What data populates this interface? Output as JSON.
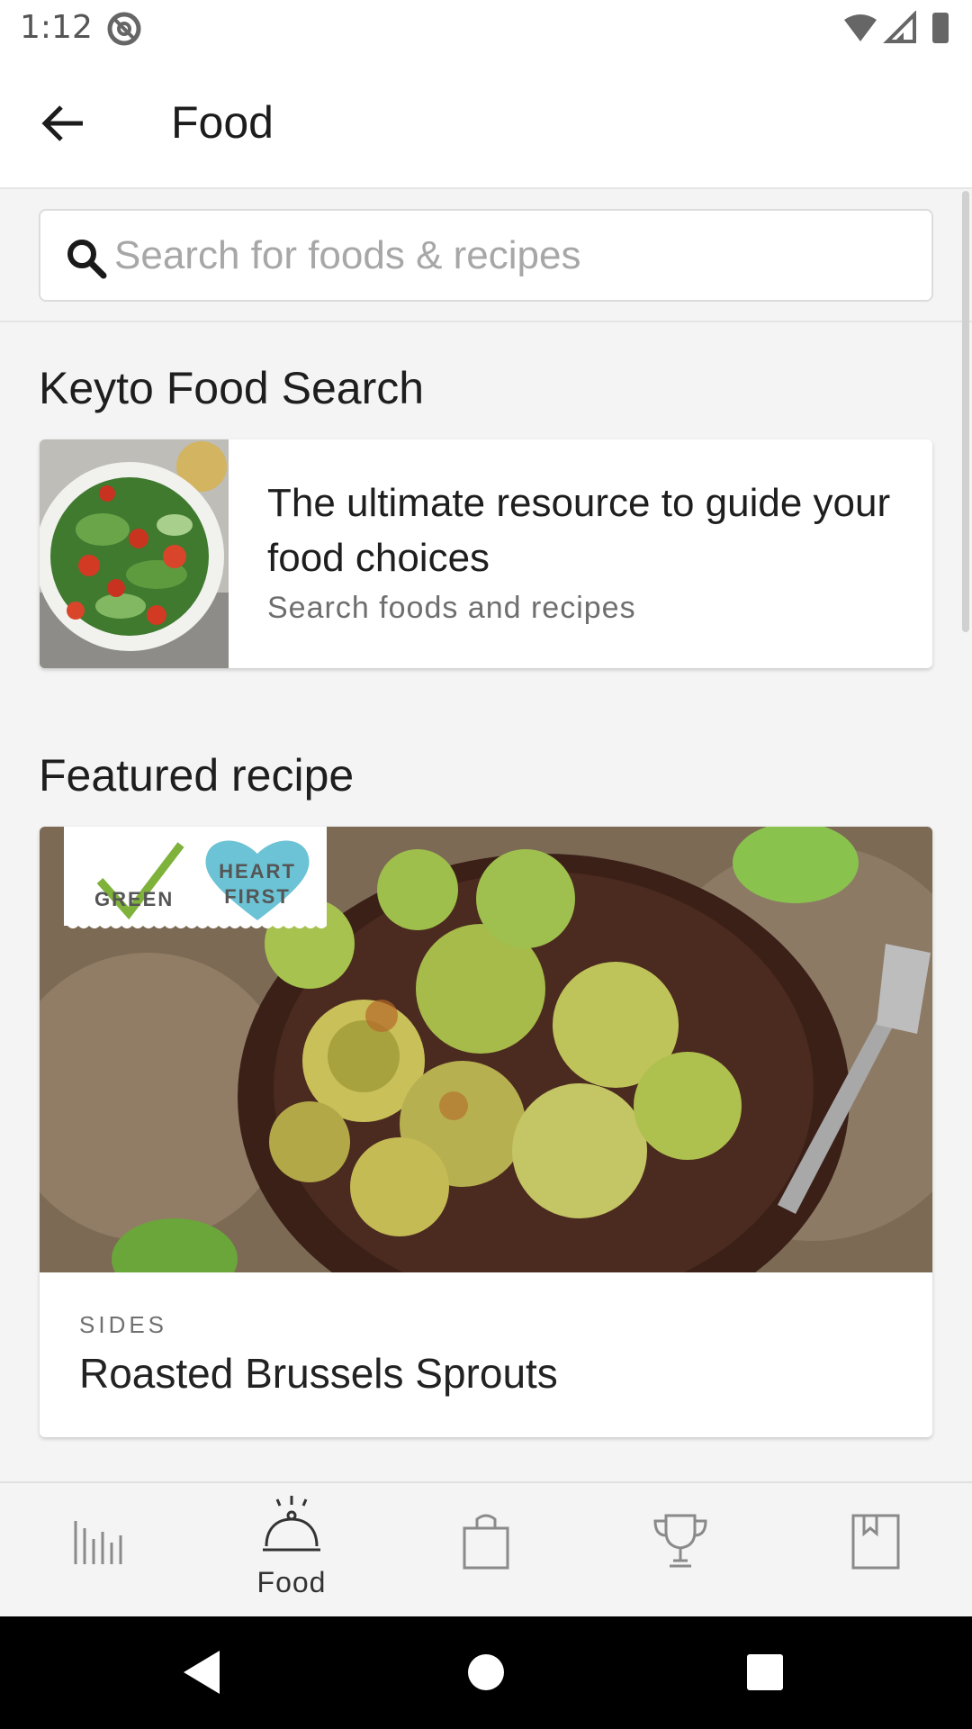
{
  "status_bar": {
    "time": "1:12"
  },
  "app_bar": {
    "title": "Food"
  },
  "search": {
    "placeholder": "Search for foods & recipes"
  },
  "keyto_section": {
    "heading": "Keyto Food Search",
    "card": {
      "title": "The ultimate resource to guide your food choices",
      "subtitle": "Search foods and recipes"
    }
  },
  "featured_section": {
    "heading": "Featured recipe",
    "badges": [
      "GREEN",
      "HEART",
      "FIRST"
    ],
    "recipe": {
      "category": "SIDES",
      "name": "Roasted Brussels Sprouts"
    }
  },
  "bottom_nav": {
    "items": [
      {
        "icon": "chart-bars-icon",
        "label": ""
      },
      {
        "icon": "cloche-icon",
        "label": "Food",
        "active": true
      },
      {
        "icon": "shopping-bag-icon",
        "label": ""
      },
      {
        "icon": "trophy-icon",
        "label": ""
      },
      {
        "icon": "bookmark-icon",
        "label": ""
      }
    ]
  },
  "colors": {
    "accent_green": "#7fb23a",
    "heart_teal": "#6cc3d5",
    "nav_icon": "#8a8a8a"
  }
}
